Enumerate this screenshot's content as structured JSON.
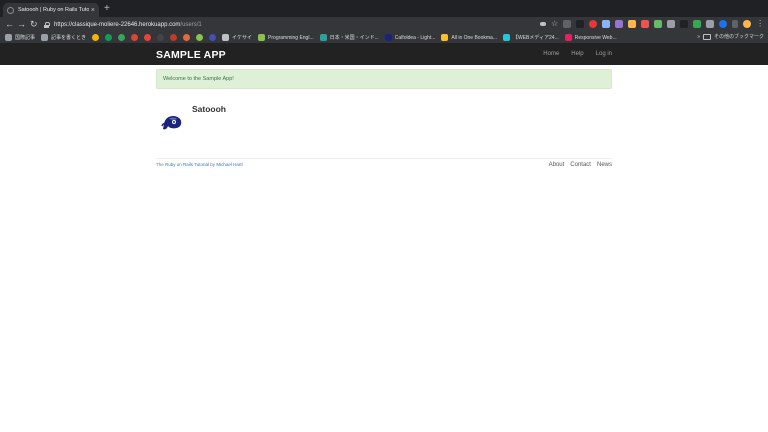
{
  "browser": {
    "tab_title": "Satoooh | Ruby on Rails Tutorial Sample App",
    "tab_close": "×",
    "new_tab": "+",
    "back": "←",
    "forward": "→",
    "reload": "↻",
    "url_host": "https://classique-moliere-22646.herokuapp.com",
    "url_path": "/users/1",
    "bookmarks": [
      {
        "label": "国際記事",
        "color": "#9aa0a6"
      },
      {
        "label": "記事を書くとき",
        "color": "#9aa0a6"
      },
      {
        "label": "",
        "color": "#f4b400"
      },
      {
        "label": "",
        "color": "#0f9d58"
      },
      {
        "label": "",
        "color": "#34a853"
      },
      {
        "label": "",
        "color": "#db4437"
      },
      {
        "label": "",
        "color": "#ea4335"
      },
      {
        "label": "",
        "color": "#444444"
      },
      {
        "label": "",
        "color": "#c0392b"
      },
      {
        "label": "",
        "color": "#e06c3c"
      },
      {
        "label": "",
        "color": "#8bc34a"
      },
      {
        "label": "",
        "color": "#3f51b5"
      },
      {
        "label": "イケサイ",
        "color": "#bdc1c6"
      },
      {
        "label": "Programming Engl...",
        "color": "#8bc34a"
      },
      {
        "label": "日本・米国・インド...",
        "color": "#26a69a"
      },
      {
        "label": "Calfoldea - Light...",
        "color": "#1a237e"
      },
      {
        "label": "All in One Bookma...",
        "color": "#fbc02d"
      },
      {
        "label": "【WEBメディア24...",
        "color": "#26c6da"
      },
      {
        "label": "Responsive Web...",
        "color": "#e91e63"
      }
    ],
    "bookmarks_overflow": "»",
    "other_bookmarks": "その他のブックマーク"
  },
  "site": {
    "logo": "SAMPLE APP",
    "nav": {
      "home": "Home",
      "help": "Help",
      "login": "Log in"
    },
    "flash": "Welcome to the Sample App!",
    "user_name": "Satoooh",
    "footer": {
      "prefix": "The ",
      "tutorial_link": "Ruby on Rails Tutorial",
      "by": " by ",
      "author_link": "Michael Hartl",
      "about": "About",
      "contact": "Contact",
      "news": "News"
    }
  },
  "colors": {
    "header_bg": "#222222",
    "flash_bg": "#dff0d8",
    "flash_text": "#3c763d",
    "link": "#337ab7"
  }
}
